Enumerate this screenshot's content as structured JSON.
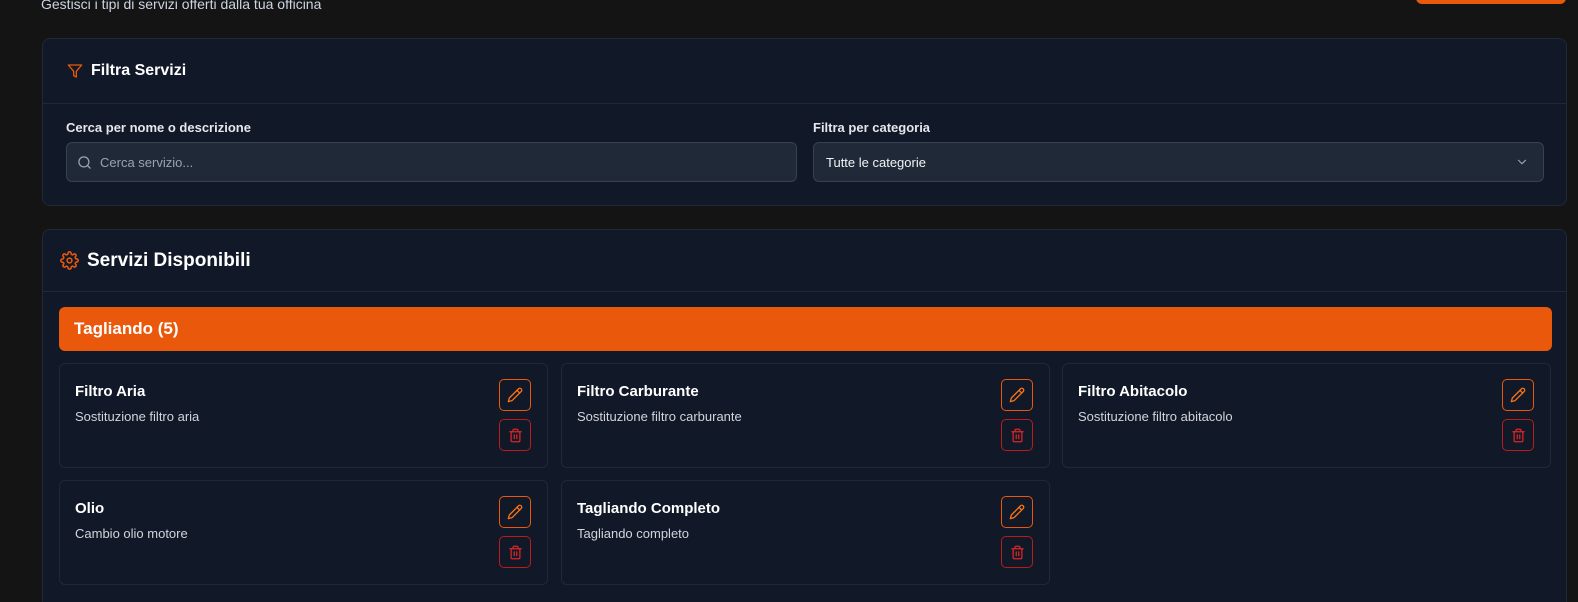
{
  "header": {
    "subtitle": "Gestisci i tipi di servizi offerti dalla tua officina"
  },
  "filters": {
    "title": "Filtra Servizi",
    "search_label": "Cerca per nome o descrizione",
    "search_placeholder": "Cerca servizio...",
    "search_value": "",
    "category_label": "Filtra per categoria",
    "category_selected": "Tutte le categorie"
  },
  "services": {
    "title": "Servizi Disponibili",
    "category_banner": "Tagliando (5)",
    "items": [
      {
        "name": "Filtro Aria",
        "description": "Sostituzione filtro aria"
      },
      {
        "name": "Filtro Carburante",
        "description": "Sostituzione filtro carburante"
      },
      {
        "name": "Filtro Abitacolo",
        "description": "Sostituzione filtro abitacolo"
      },
      {
        "name": "Olio",
        "description": "Cambio olio motore"
      },
      {
        "name": "Tagliando Completo",
        "description": "Tagliando completo"
      }
    ]
  },
  "icons": {
    "filter": "filter-icon",
    "search": "search-icon",
    "chevron": "chevron-down-icon",
    "settings": "gear-icon",
    "edit": "pencil-icon",
    "delete": "trash-icon"
  },
  "colors": {
    "accent": "#ea580c",
    "danger": "#dc2626",
    "card_background": "#111827",
    "page_background": "#141414"
  }
}
